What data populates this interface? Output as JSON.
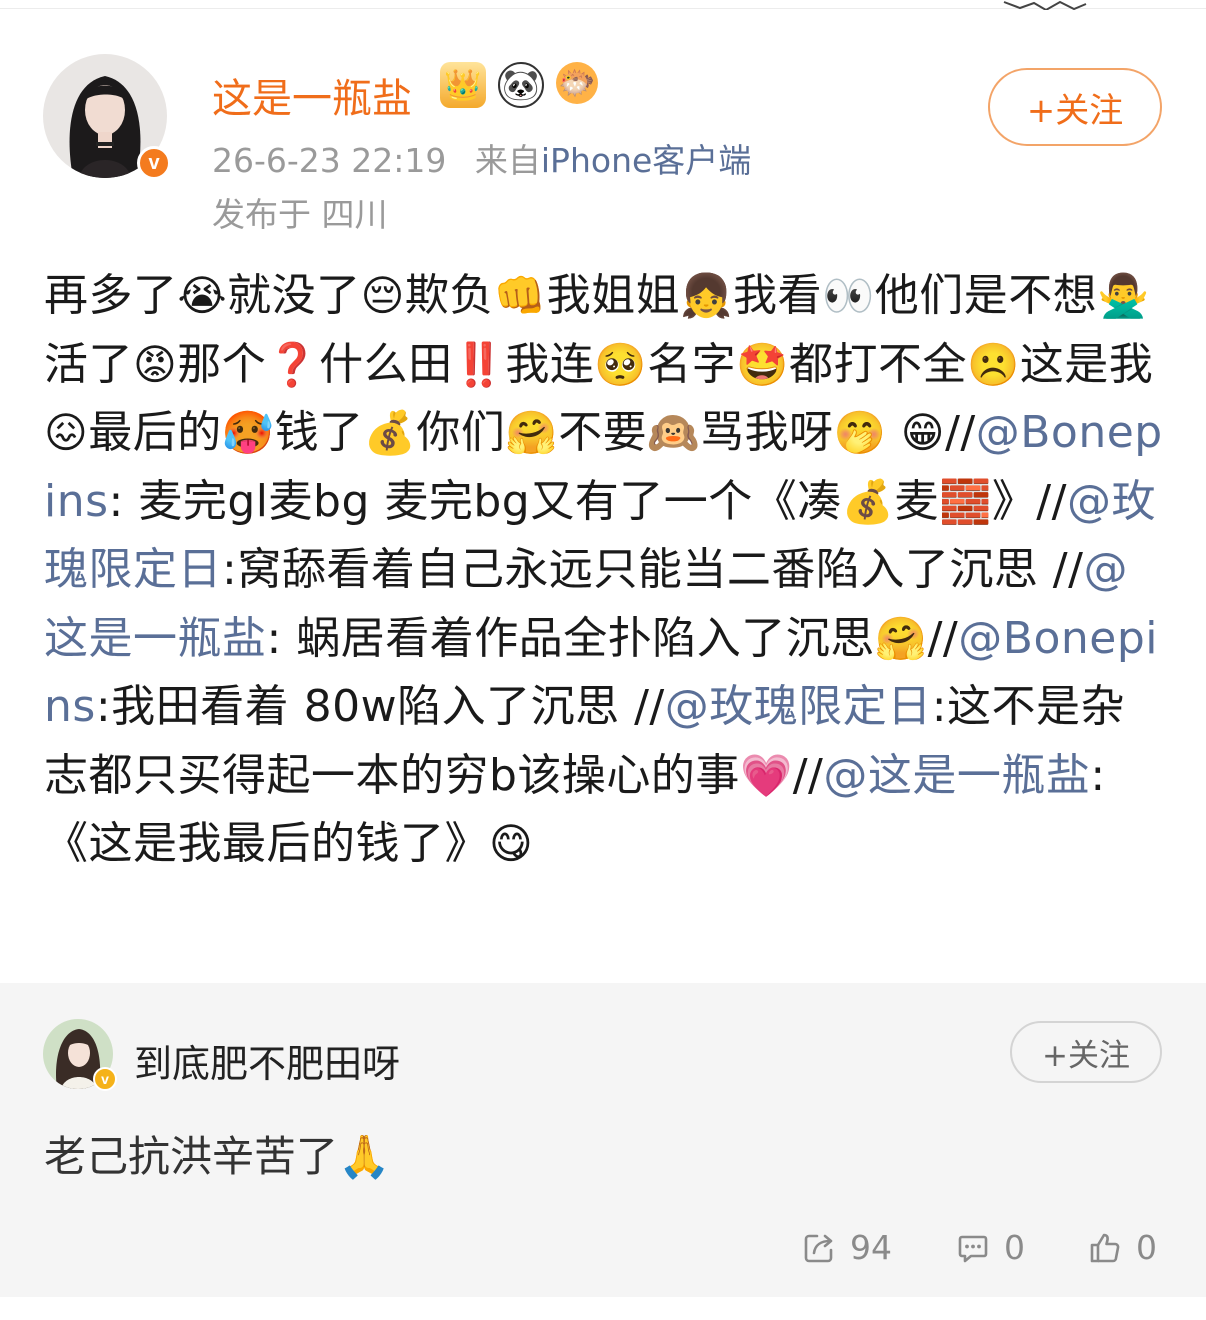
{
  "post": {
    "username": "这是一瓶盐",
    "badges": [
      "👑",
      "🐼",
      "🐡"
    ],
    "timestamp": "26-6-23 22:19",
    "from_prefix": "来自",
    "source": "iPhone客户端",
    "location": "发布于 四川",
    "follow_label": "+关注",
    "verified_mark": "v",
    "content": [
      {
        "t": "text",
        "v": "再多了"
      },
      {
        "t": "emoji",
        "v": "😭"
      },
      {
        "t": "text",
        "v": "就没了"
      },
      {
        "t": "emoji",
        "v": "😔"
      },
      {
        "t": "text",
        "v": "欺负"
      },
      {
        "t": "emoji",
        "v": "👊"
      },
      {
        "t": "text",
        "v": "我姐姐"
      },
      {
        "t": "emoji",
        "v": "👧"
      },
      {
        "t": "text",
        "v": "我看"
      },
      {
        "t": "emoji",
        "v": "👀"
      },
      {
        "t": "text",
        "v": "他们是不想"
      },
      {
        "t": "emoji",
        "v": "🙅‍♂️"
      },
      {
        "t": "text",
        "v": "活了"
      },
      {
        "t": "emoji",
        "v": "😡"
      },
      {
        "t": "text",
        "v": "那个"
      },
      {
        "t": "emoji",
        "v": "❓"
      },
      {
        "t": "text",
        "v": "什么田"
      },
      {
        "t": "emoji",
        "v": "‼️"
      },
      {
        "t": "text",
        "v": "我连"
      },
      {
        "t": "emoji",
        "v": "🥺"
      },
      {
        "t": "text",
        "v": "名字"
      },
      {
        "t": "emoji",
        "v": "🤩"
      },
      {
        "t": "text",
        "v": "都打不全"
      },
      {
        "t": "emoji",
        "v": "☹️"
      },
      {
        "t": "text",
        "v": "这是我"
      },
      {
        "t": "emoji",
        "v": "😖"
      },
      {
        "t": "text",
        "v": "最后的"
      },
      {
        "t": "emoji",
        "v": "🥵"
      },
      {
        "t": "text",
        "v": "钱了"
      },
      {
        "t": "emoji",
        "v": "💰"
      },
      {
        "t": "text",
        "v": "你们"
      },
      {
        "t": "emoji",
        "v": "🤗"
      },
      {
        "t": "text",
        "v": "不要"
      },
      {
        "t": "emoji",
        "v": "🙉"
      },
      {
        "t": "text",
        "v": "骂我呀"
      },
      {
        "t": "emoji",
        "v": "🤭"
      },
      {
        "t": "text",
        "v": " "
      },
      {
        "t": "emoji",
        "v": "😁"
      },
      {
        "t": "text",
        "v": "//"
      },
      {
        "t": "link",
        "v": "@Bonepins"
      },
      {
        "t": "text",
        "v": ": 麦完gl麦bg 麦完bg又有了一个《凑"
      },
      {
        "t": "emoji",
        "v": "💰"
      },
      {
        "t": "text",
        "v": "麦"
      },
      {
        "t": "emoji",
        "v": "🧱"
      },
      {
        "t": "text",
        "v": "》//"
      },
      {
        "t": "link",
        "v": "@玫瑰限定日"
      },
      {
        "t": "text",
        "v": ":窝舔看着自己永远只能当二番陷入了沉思 //"
      },
      {
        "t": "link",
        "v": "@这是一瓶盐"
      },
      {
        "t": "text",
        "v": ": 蜗居看着作品全扑陷入了沉思"
      },
      {
        "t": "emoji",
        "v": "🤗"
      },
      {
        "t": "text",
        "v": "//"
      },
      {
        "t": "link",
        "v": "@Bonepins"
      },
      {
        "t": "text",
        "v": ":我田看着 80w陷入了沉思 //"
      },
      {
        "t": "link",
        "v": "@玫瑰限定日"
      },
      {
        "t": "text",
        "v": ":这不是杂志都只买得起一本的穷b该操心的事"
      },
      {
        "t": "emoji",
        "v": "💗"
      },
      {
        "t": "text",
        "v": "//"
      },
      {
        "t": "link",
        "v": "@这是一瓶盐"
      },
      {
        "t": "text",
        "v": ":《这是我最后的钱了》"
      },
      {
        "t": "emoji",
        "v": "😋"
      }
    ]
  },
  "comment": {
    "username": "到底肥不肥田呀",
    "follow_label": "+关注",
    "verified_mark": "v",
    "text": "老己抗洪辛苦了🙏"
  },
  "actions": {
    "repost_count": "94",
    "comment_count": "0",
    "like_count": "0"
  },
  "colors": {
    "username": "#f06d1a",
    "link": "#5a6f97",
    "meta": "#9a9a9a",
    "verified": "#f47b1e"
  }
}
